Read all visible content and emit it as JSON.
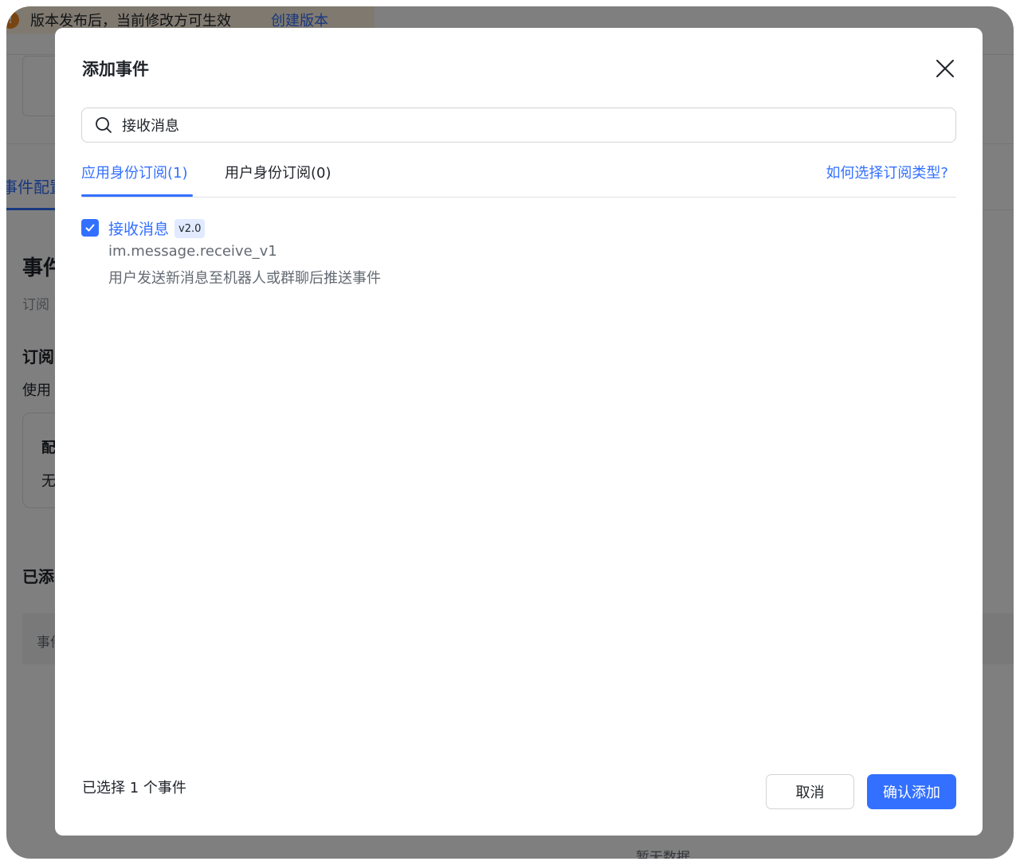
{
  "background": {
    "banner": {
      "text": "版本发布后，当前修改方可生效",
      "link": "创建版本",
      "icon": "warning-icon"
    },
    "nav_tab": "事件配置",
    "section_title": "事件",
    "section_subtitle": "订阅",
    "subscribe_heading": "订阅",
    "usage_text": "使用",
    "card_title": "配",
    "card_text": "无",
    "added_heading": "已添",
    "table_header": "事件",
    "empty_text": "暂无数据"
  },
  "modal": {
    "title": "添加事件",
    "search": {
      "value": "接收消息",
      "placeholder": ""
    },
    "tabs": [
      {
        "label": "应用身份订阅(1)",
        "active": true
      },
      {
        "label": "用户身份订阅(0)",
        "active": false
      }
    ],
    "help_link": "如何选择订阅类型?",
    "events": [
      {
        "name": "接收消息",
        "version": "v2.0",
        "key": "im.message.receive_v1",
        "description": "用户发送新消息至机器人或群聊后推送事件",
        "checked": true
      }
    ],
    "footer": {
      "selected_text": "已选择 1 个事件",
      "cancel_label": "取消",
      "confirm_label": "确认添加"
    }
  },
  "colors": {
    "accent": "#3370ff",
    "warning": "#f08a24",
    "badge_bg": "#e1eaff"
  }
}
